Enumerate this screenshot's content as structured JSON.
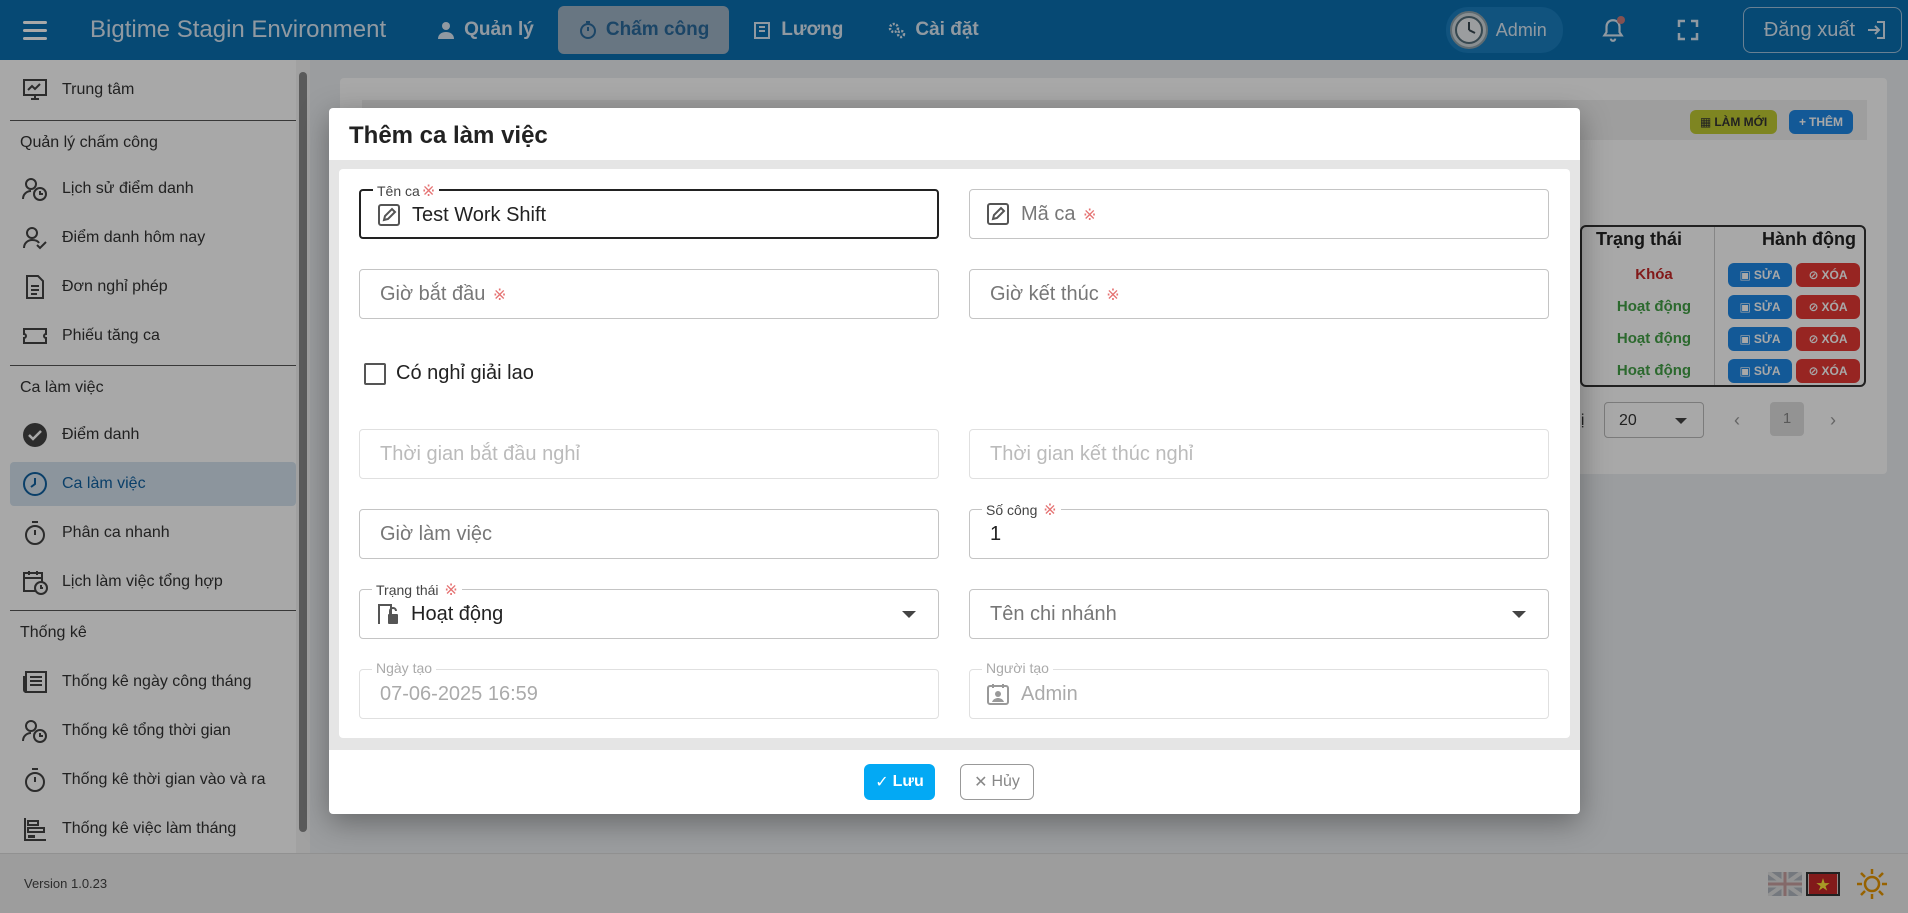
{
  "app": {
    "title": "Bigtime Stagin Environment",
    "nav": [
      {
        "label": "Quản lý",
        "icon": "user-icon"
      },
      {
        "label": "Chấm công",
        "icon": "stopwatch-icon",
        "active": true
      },
      {
        "label": "Lương",
        "icon": "book-icon"
      },
      {
        "label": "Cài đặt",
        "icon": "gears-icon"
      }
    ],
    "user": "Admin",
    "logout_label": "Đăng xuất"
  },
  "sidebar": {
    "items": [
      {
        "label": "Trung tâm",
        "icon": "dashboard-monitor-icon"
      },
      {
        "label": "Lịch sử điểm danh",
        "icon": "user-clock-icon"
      },
      {
        "label": "Điểm danh hôm nay",
        "icon": "user-check-icon"
      },
      {
        "label": "Đơn nghỉ phép",
        "icon": "document-icon"
      },
      {
        "label": "Phiếu tăng ca",
        "icon": "ticket-icon"
      },
      {
        "label": "Điểm danh",
        "icon": "check-circle-icon"
      },
      {
        "label": "Ca làm việc",
        "icon": "clock-icon",
        "active": true
      },
      {
        "label": "Phân ca nhanh",
        "icon": "timer-icon"
      },
      {
        "label": "Lịch làm việc tổng hợp",
        "icon": "calendar-clock-icon"
      },
      {
        "label": "Thống kê ngày công tháng",
        "icon": "newspaper-icon"
      },
      {
        "label": "Thống kê tổng thời gian",
        "icon": "user-clock-icon"
      },
      {
        "label": "Thống kê thời gian vào và ra",
        "icon": "timer-icon"
      },
      {
        "label": "Thống kê việc làm tháng",
        "icon": "bar-chart-icon"
      }
    ],
    "sections": [
      "Quản lý chấm công",
      "Ca làm việc",
      "Thống kê"
    ]
  },
  "background": {
    "refresh_label": "LÀM MỚI",
    "add_label": "THÊM",
    "table": {
      "headers": [
        "Trạng thái",
        "Hành động"
      ],
      "rows": [
        {
          "status": "Khóa",
          "status_color": "#c62828"
        },
        {
          "status": "Hoạt động",
          "status_color": "#43a047"
        },
        {
          "status": "Hoạt động",
          "status_color": "#43a047"
        },
        {
          "status": "Hoạt động",
          "status_color": "#43a047"
        }
      ],
      "edit_label": "SỬA",
      "delete_label": "XÓA"
    },
    "page_size_label": "hị",
    "page_size": "20",
    "current_page": "1"
  },
  "modal": {
    "title": "Thêm ca làm việc",
    "fields": {
      "ten_ca": {
        "label": "Tên ca",
        "value": "Test Work Shift"
      },
      "ma_ca": {
        "placeholder": "Mã ca"
      },
      "gio_bat_dau": {
        "placeholder": "Giờ bắt đầu"
      },
      "gio_ket_thuc": {
        "placeholder": "Giờ kết thúc"
      },
      "co_nghi": {
        "label": "Có nghỉ giải lao",
        "checked": false
      },
      "tg_bat_dau_nghi": {
        "placeholder": "Thời gian bắt đầu nghỉ"
      },
      "tg_ket_thuc_nghi": {
        "placeholder": "Thời gian kết thúc nghỉ"
      },
      "gio_lam_viec": {
        "placeholder": "Giờ làm việc"
      },
      "so_cong": {
        "label": "Số công",
        "value": "1"
      },
      "trang_thai": {
        "label": "Trạng thái",
        "value": "Hoạt động"
      },
      "ten_chi_nhanh": {
        "placeholder": "Tên chi nhánh"
      },
      "ngay_tao": {
        "label": "Ngày tạo",
        "value": "07-06-2025 16:59"
      },
      "nguoi_tao": {
        "label": "Người tạo",
        "value": "Admin"
      }
    },
    "required_mark": "※",
    "save_label": "Lưu",
    "cancel_label": "Hủy"
  },
  "footer": {
    "version": "Version 1.0.23"
  },
  "colors": {
    "topbar": "#0a70b0",
    "primary": "#1e88e5",
    "save": "#03a9f4",
    "danger": "#e53935",
    "active_green": "#43a047"
  }
}
